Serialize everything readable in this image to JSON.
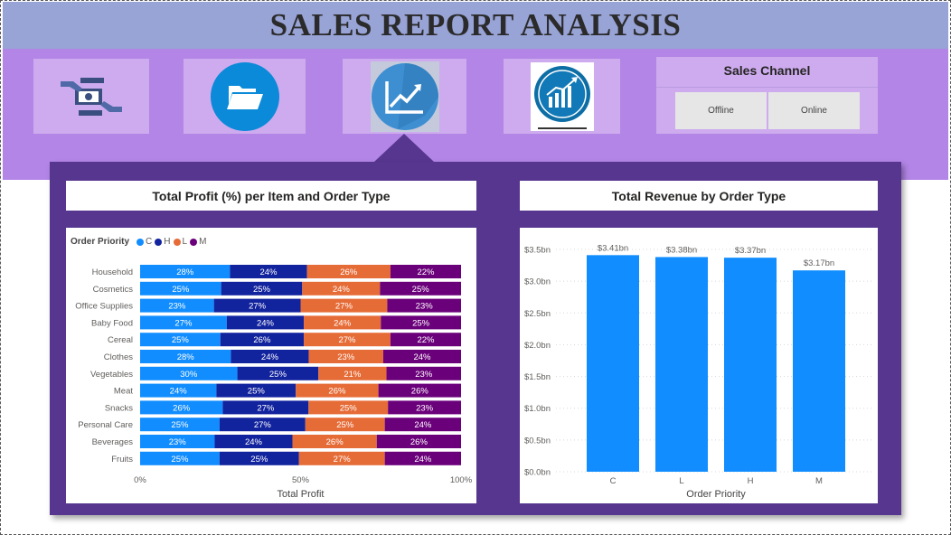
{
  "header": {
    "title": "SALES REPORT ANALYSIS"
  },
  "nav": {
    "tiles": [
      {
        "icon": "money-exchange-icon"
      },
      {
        "icon": "folder-icon"
      },
      {
        "icon": "trend-chart-icon"
      },
      {
        "icon": "growth-chart-icon"
      }
    ]
  },
  "slicer": {
    "title": "Sales Channel",
    "options": [
      "Offline",
      "Online"
    ]
  },
  "colors": {
    "C": "#118dff",
    "H": "#12239e",
    "L": "#e66c37",
    "M": "#6b007b",
    "bar": "#118dff",
    "panel": "#57368f",
    "band": "#b285e6",
    "title_band": "#98a3d6"
  },
  "chart_data": [
    {
      "type": "bar",
      "orientation": "horizontal",
      "stacked": "100%",
      "title": "Total Profit (%) per Item and Order Type",
      "xlabel": "Total Profit",
      "ylabel": "",
      "legend_title": "Order Priority",
      "legend_position": "top-left",
      "categories": [
        "Household",
        "Cosmetics",
        "Office Supplies",
        "Baby Food",
        "Cereal",
        "Clothes",
        "Vegetables",
        "Meat",
        "Snacks",
        "Personal Care",
        "Beverages",
        "Fruits"
      ],
      "series": [
        {
          "name": "C",
          "values": [
            28,
            25,
            23,
            27,
            25,
            28,
            30,
            24,
            26,
            25,
            23,
            25
          ]
        },
        {
          "name": "H",
          "values": [
            24,
            25,
            27,
            24,
            26,
            24,
            25,
            25,
            27,
            27,
            24,
            25
          ]
        },
        {
          "name": "L",
          "values": [
            26,
            24,
            27,
            24,
            27,
            23,
            21,
            26,
            25,
            25,
            26,
            27
          ]
        },
        {
          "name": "M",
          "values": [
            22,
            25,
            23,
            25,
            22,
            24,
            23,
            26,
            23,
            24,
            26,
            24
          ]
        }
      ],
      "xticks": [
        "0%",
        "50%",
        "100%"
      ],
      "xlim": [
        0,
        100
      ]
    },
    {
      "type": "bar",
      "title": "Total Revenue by Order Type",
      "xlabel": "Order Priority",
      "ylabel": "",
      "categories": [
        "C",
        "L",
        "H",
        "M"
      ],
      "values": [
        3.41,
        3.38,
        3.37,
        3.17
      ],
      "labels": [
        "$3.41bn",
        "$3.38bn",
        "$3.37bn",
        "$3.17bn"
      ],
      "yticks": [
        "$0.0bn",
        "$0.5bn",
        "$1.0bn",
        "$1.5bn",
        "$2.0bn",
        "$2.5bn",
        "$3.0bn",
        "$3.5bn"
      ],
      "ylim": [
        0,
        3.5
      ],
      "grid": true
    }
  ]
}
